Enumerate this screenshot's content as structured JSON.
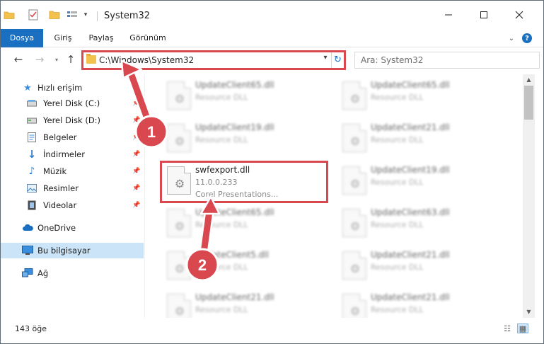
{
  "window": {
    "title": "System32"
  },
  "ribbon": {
    "tabs": [
      "Dosya",
      "Giriş",
      "Paylaş",
      "Görünüm"
    ],
    "help": "?"
  },
  "address": {
    "path": "C:\\Windows\\System32"
  },
  "search": {
    "placeholder": "Ara: System32"
  },
  "sidebar": {
    "items": [
      {
        "label": "Hızlı erişim",
        "icon": "star-icon"
      },
      {
        "label": "Yerel Disk (C:)",
        "icon": "drive-icon"
      },
      {
        "label": "Yerel Disk (D:)",
        "icon": "drive-icon"
      },
      {
        "label": "Belgeler",
        "icon": "documents-icon"
      },
      {
        "label": "İndirmeler",
        "icon": "download-icon"
      },
      {
        "label": "Müzik",
        "icon": "music-icon"
      },
      {
        "label": "Resimler",
        "icon": "pictures-icon"
      },
      {
        "label": "Videolar",
        "icon": "video-icon"
      },
      {
        "label": "OneDrive",
        "icon": "cloud-icon"
      },
      {
        "label": "Bu bilgisayar",
        "icon": "computer-icon"
      },
      {
        "label": "Ağ",
        "icon": "network-icon"
      }
    ]
  },
  "files": [
    {
      "name": "UpdateClient65.dll",
      "type": "Resource DLL"
    },
    {
      "name": "UpdateClient65.dll",
      "type": "Resource DLL"
    },
    {
      "name": "UpdateClient19.dll",
      "type": "Resource DLL"
    },
    {
      "name": "UpdateClient21.dll",
      "type": "Resource DLL"
    },
    {
      "name": "swfexport.dll",
      "version": "11.0.0.233",
      "company": "Corel Presentations..."
    },
    {
      "name": "UpdateClient19.dll",
      "type": "Resource DLL"
    },
    {
      "name": "UpdateClient65.dll",
      "type": "Resource DLL"
    },
    {
      "name": "UpdateClient63.dll",
      "type": "Resource DLL"
    },
    {
      "name": "UpdateClient5.dll",
      "type": "Resource DLL"
    },
    {
      "name": "UpdateClient21.dll",
      "type": "Resource DLL"
    },
    {
      "name": "UpdateClient21.dll",
      "type": "Resource DLL"
    },
    {
      "name": "UpdateClient21.dll",
      "type": "Resource DLL"
    }
  ],
  "status": {
    "count": "143 öğe"
  },
  "annotations": {
    "step1": "1",
    "step2": "2",
    "color": "#d9474f"
  }
}
